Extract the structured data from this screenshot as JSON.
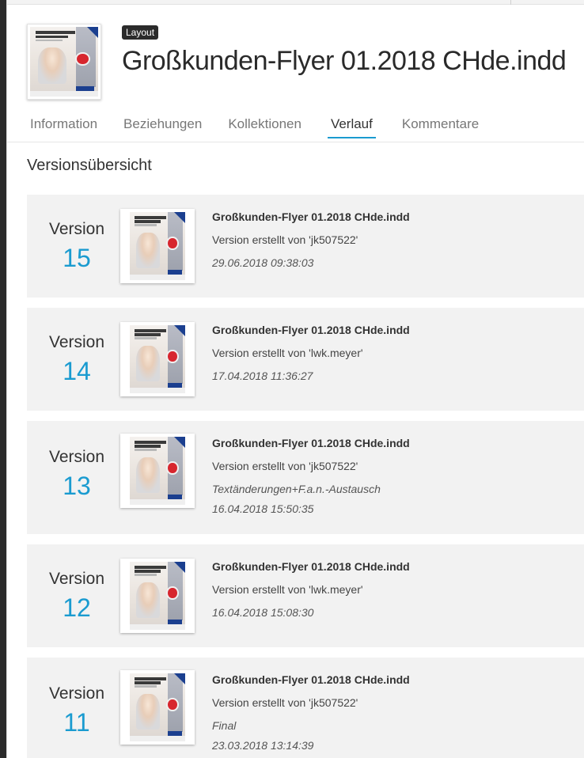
{
  "asset": {
    "type_badge": "Layout",
    "title": "Großkunden-Flyer 01.2018 CHde.indd"
  },
  "tabs": [
    {
      "label": "Information",
      "active": false
    },
    {
      "label": "Beziehungen",
      "active": false
    },
    {
      "label": "Kollektionen",
      "active": false
    },
    {
      "label": "Verlauf",
      "active": true
    },
    {
      "label": "Kommentare",
      "active": false
    }
  ],
  "section": {
    "title": "Versionsübersicht"
  },
  "version_word": "Version",
  "versions": [
    {
      "number": "15",
      "name": "Großkunden-Flyer 01.2018 CHde.indd",
      "creator": "Version erstellt von 'jk507522'",
      "comment": "",
      "date": "29.06.2018 09:38:03"
    },
    {
      "number": "14",
      "name": "Großkunden-Flyer 01.2018 CHde.indd",
      "creator": "Version erstellt von 'lwk.meyer'",
      "comment": "",
      "date": "17.04.2018 11:36:27"
    },
    {
      "number": "13",
      "name": "Großkunden-Flyer 01.2018 CHde.indd",
      "creator": "Version erstellt von 'jk507522'",
      "comment": "Textänderungen+F.a.n.-Austausch",
      "date": "16.04.2018 15:50:35"
    },
    {
      "number": "12",
      "name": "Großkunden-Flyer 01.2018 CHde.indd",
      "creator": "Version erstellt von 'lwk.meyer'",
      "comment": "",
      "date": "16.04.2018 15:08:30"
    },
    {
      "number": "11",
      "name": "Großkunden-Flyer 01.2018 CHde.indd",
      "creator": "Version erstellt von 'jk507522'",
      "comment": "Final",
      "date": "23.03.2018 13:14:39"
    }
  ],
  "colors": {
    "accent": "#1a9bd0",
    "card_background": "#f2f2f2",
    "badge_background": "#2b2b2b"
  }
}
